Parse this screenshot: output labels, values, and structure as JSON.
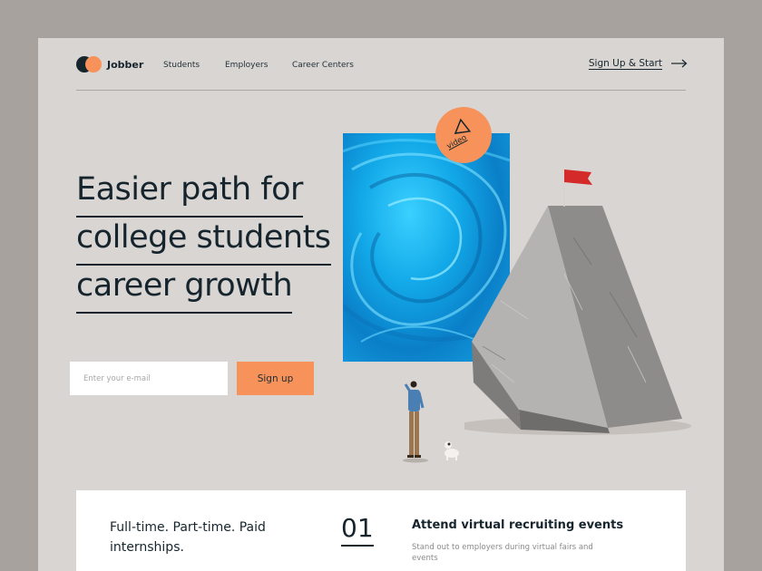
{
  "brand": {
    "name": "Jobber"
  },
  "nav": {
    "students": "Students",
    "employers": "Employers",
    "career_centers": "Career Centers",
    "signup_cta": "Sign Up & Start"
  },
  "hero": {
    "headline_lines": [
      "Easier path for",
      "college students",
      "career growth"
    ],
    "email_placeholder": "Enter your e-mail",
    "signup_button": "Sign up",
    "video_label": "video"
  },
  "feature_card": {
    "left_text": "Full-time. Part-time. Paid internships.",
    "number": "01",
    "title": "Attend virtual recruiting events",
    "description": "Stand out to employers during virtual fairs and events"
  },
  "colors": {
    "accent": "#f7935a",
    "dark": "#16252d",
    "page_bg": "#d9d5d2",
    "outer_bg": "#a8a29e"
  },
  "icons": {
    "arrow": "arrow-right-icon",
    "play": "play-triangle-icon",
    "flag": "flag-icon"
  }
}
